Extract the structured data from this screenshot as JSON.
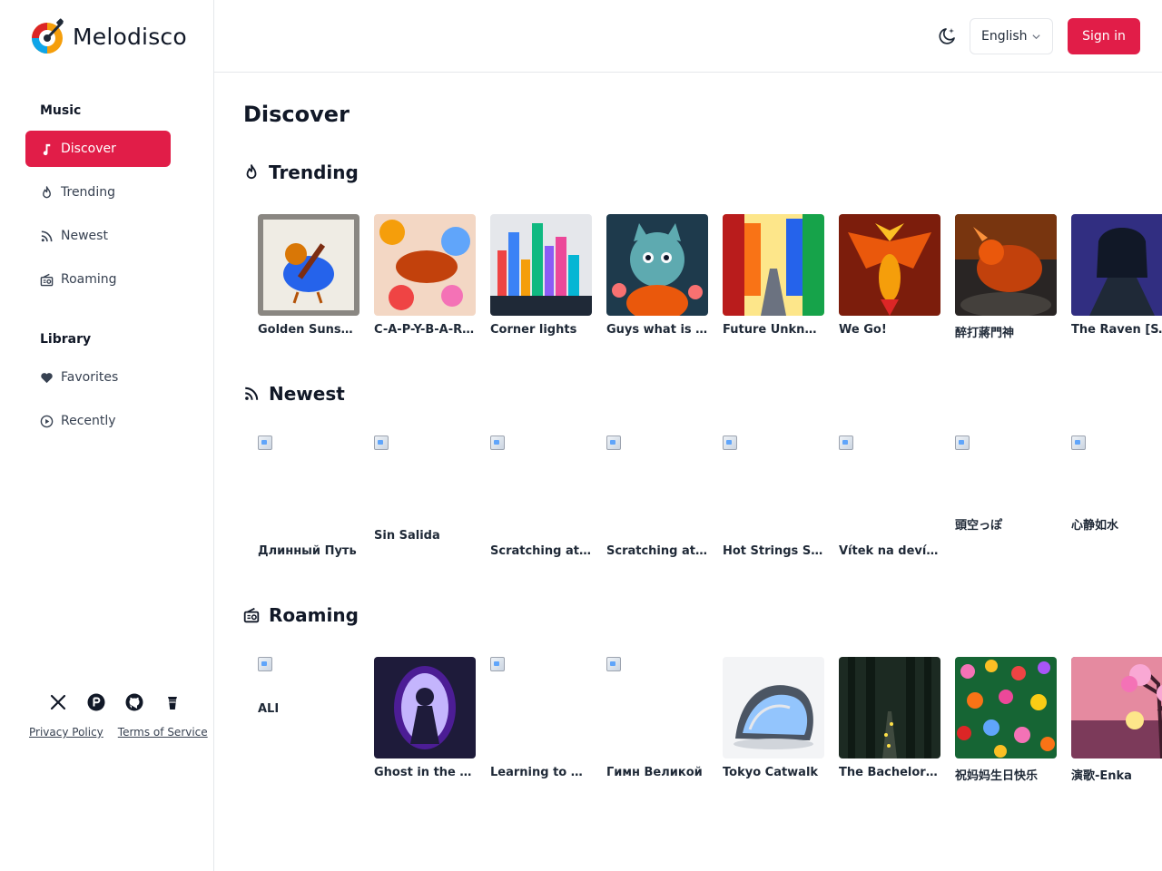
{
  "brand": {
    "name": "Melodisco"
  },
  "sidebar": {
    "music_title": "Music",
    "music_items": [
      {
        "label": "Discover",
        "icon": "music-note-icon",
        "active": true
      },
      {
        "label": "Trending",
        "icon": "flame-icon"
      },
      {
        "label": "Newest",
        "icon": "rss-icon"
      },
      {
        "label": "Roaming",
        "icon": "radio-icon"
      }
    ],
    "library_title": "Library",
    "library_items": [
      {
        "label": "Favorites",
        "icon": "heart-icon"
      },
      {
        "label": "Recently",
        "icon": "play-circle-icon"
      }
    ],
    "socials": [
      "x-icon",
      "producthunt-icon",
      "github-icon",
      "coffee-icon"
    ],
    "privacy": "Privacy Policy",
    "terms": "Terms of Service"
  },
  "header": {
    "language": "English",
    "signin": "Sign in"
  },
  "main": {
    "title": "Discover",
    "sections": {
      "trending": {
        "title": "Trending",
        "items": [
          "Golden Sunshine",
          "C-A-P-Y-B-A-R-A",
          "Corner lights",
          "Guys what is happening",
          "Future Unknown",
          "We Go!",
          "醉打蔣門神",
          "The Raven [SSL]"
        ]
      },
      "newest": {
        "title": "Newest",
        "items": [
          "Длинный Путь",
          "Sin Salida",
          "Scratching at the door",
          "Scratching at the door",
          "Hot Strings Session",
          "Vítek na devítce",
          "頭空っぽ",
          "心静如水"
        ]
      },
      "roaming": {
        "title": "Roaming",
        "items": [
          "ALI",
          "Ghost in the Mirror",
          "Learning to Grow",
          "Гимн Великой",
          "Tokyo Catwalk",
          "The Bachelor Song",
          "祝妈妈生日快乐",
          "演歌-Enka"
        ]
      }
    }
  },
  "colors": {
    "accent": "#e11d48",
    "border": "#e5e7eb",
    "text": "#1f2937"
  }
}
